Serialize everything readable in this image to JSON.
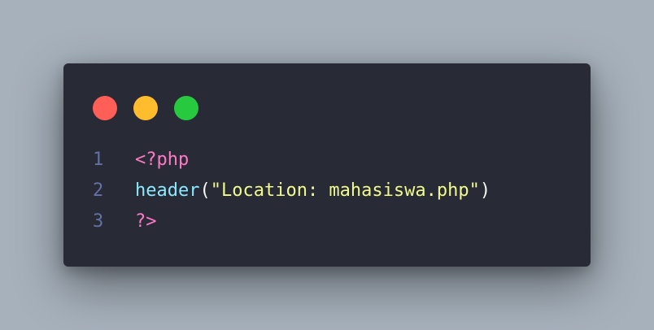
{
  "colors": {
    "background": "#a7b1bc",
    "window": "#282a36",
    "close": "#ff5f56",
    "minimize": "#ffbd2e",
    "maximize": "#27c93f",
    "line_number": "#6272a4",
    "keyword": "#ff79c6",
    "function": "#8be9fd",
    "string": "#f1fa8c",
    "plain": "#f8f8f2"
  },
  "controls": [
    {
      "name": "close-button",
      "color": "#ff5f56"
    },
    {
      "name": "minimize-button",
      "color": "#ffbd2e"
    },
    {
      "name": "maximize-button",
      "color": "#27c93f"
    }
  ],
  "code": {
    "lines": [
      {
        "number": "1",
        "tokens": [
          {
            "text": "<?php",
            "kind": "keyword"
          }
        ]
      },
      {
        "number": "2",
        "tokens": [
          {
            "text": "header",
            "kind": "function"
          },
          {
            "text": "(",
            "kind": "plain"
          },
          {
            "text": "\"Location: mahasiswa.php\"",
            "kind": "string"
          },
          {
            "text": ")",
            "kind": "plain"
          }
        ]
      },
      {
        "number": "3",
        "tokens": [
          {
            "text": "?>",
            "kind": "keyword"
          }
        ]
      }
    ]
  }
}
